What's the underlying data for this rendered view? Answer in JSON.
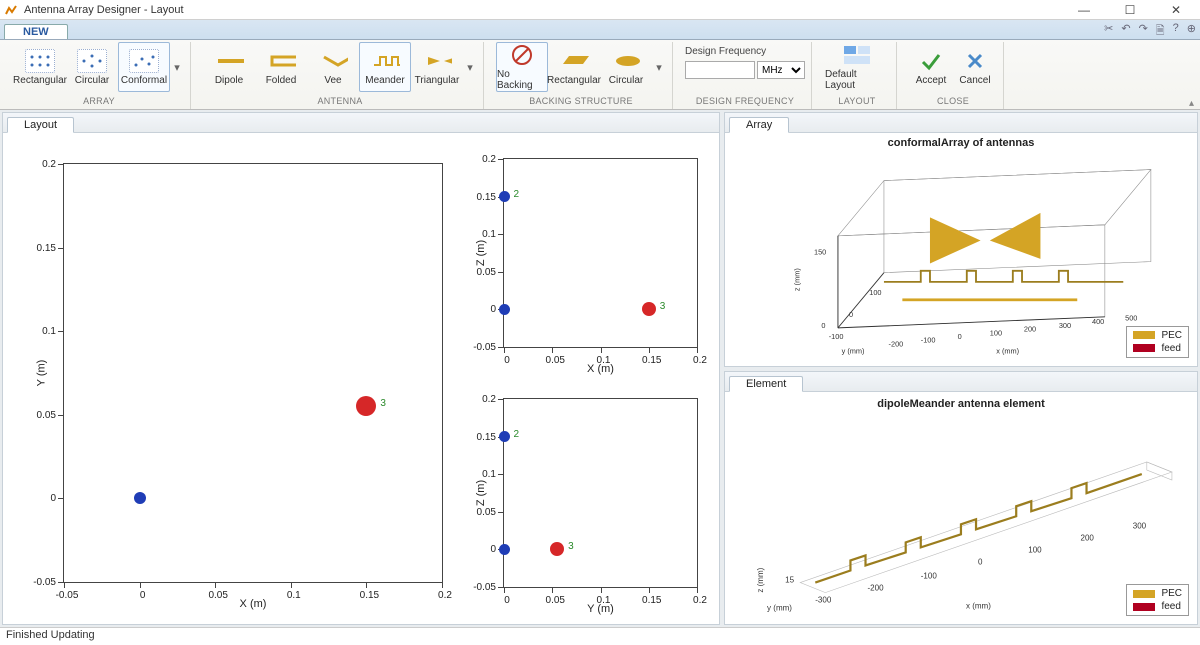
{
  "window": {
    "title": "Antenna Array Designer - Layout"
  },
  "ribbon": {
    "tab": "NEW",
    "groups": {
      "array": {
        "label": "ARRAY",
        "items": [
          {
            "name": "Rectangular"
          },
          {
            "name": "Circular"
          },
          {
            "name": "Conformal"
          }
        ]
      },
      "antenna": {
        "label": "ANTENNA",
        "items": [
          {
            "name": "Dipole"
          },
          {
            "name": "Folded"
          },
          {
            "name": "Vee"
          },
          {
            "name": "Meander"
          },
          {
            "name": "Triangular"
          }
        ]
      },
      "backing": {
        "label": "BACKING STRUCTURE",
        "items": [
          {
            "name": "No Backing"
          },
          {
            "name": "Rectangular"
          },
          {
            "name": "Circular"
          }
        ]
      },
      "design_freq": {
        "label": "DESIGN FREQUENCY",
        "heading": "Design Frequency",
        "unit": "MHz"
      },
      "layout_btn": {
        "label": "LAYOUT",
        "btn": "Default Layout"
      },
      "close": {
        "label": "CLOSE",
        "accept": "Accept",
        "cancel": "Cancel"
      }
    }
  },
  "panes": {
    "layout_tab": "Layout",
    "array_tab": "Array",
    "element_tab": "Element"
  },
  "chart_data": [
    {
      "type": "scatter",
      "id": "layout_xy",
      "xlabel": "X (m)",
      "ylabel": "Y (m)",
      "xticks": [
        -0.05,
        0,
        0.05,
        0.1,
        0.15,
        0.2
      ],
      "yticks": [
        -0.05,
        0,
        0.05,
        0.1,
        0.15,
        0.2
      ],
      "points": [
        {
          "x": 0,
          "y": 0,
          "color": "blue",
          "label": ""
        },
        {
          "x": 0.15,
          "y": 0.055,
          "color": "red",
          "label": "3"
        }
      ]
    },
    {
      "type": "scatter",
      "id": "layout_xz",
      "xlabel": "X (m)",
      "ylabel": "Z (m)",
      "xticks": [
        0,
        0.05,
        0.1,
        0.15,
        0.2
      ],
      "yticks": [
        -0.05,
        0,
        0.05,
        0.1,
        0.15,
        0.2
      ],
      "points": [
        {
          "x": 0,
          "y": 0,
          "color": "blue",
          "label": ""
        },
        {
          "x": 0,
          "y": 0.15,
          "color": "blue",
          "label": "2"
        },
        {
          "x": 0.15,
          "y": 0,
          "color": "red",
          "label": "3"
        }
      ]
    },
    {
      "type": "scatter",
      "id": "layout_yz",
      "xlabel": "Y (m)",
      "ylabel": "Z (m)",
      "xticks": [
        0,
        0.05,
        0.1,
        0.15,
        0.2
      ],
      "yticks": [
        -0.05,
        0,
        0.05,
        0.1,
        0.15,
        0.2
      ],
      "points": [
        {
          "x": 0,
          "y": 0,
          "color": "blue",
          "label": ""
        },
        {
          "x": 0,
          "y": 0.15,
          "color": "blue",
          "label": "2"
        },
        {
          "x": 0.055,
          "y": 0,
          "color": "red",
          "label": "3"
        }
      ]
    }
  ],
  "view3d": {
    "array_title": "conformalArray of antennas",
    "element_title": "dipoleMeander antenna element",
    "axes": {
      "x": "x (mm)",
      "y": "y (mm)",
      "z": "z (mm)"
    },
    "array_xticks": [
      -200,
      -100,
      0,
      100,
      200,
      300,
      400,
      500
    ],
    "array_yticks": [
      -100,
      0,
      100
    ],
    "array_zticks": [
      0,
      150
    ],
    "element_xticks": [
      -300,
      -200,
      -100,
      0,
      100,
      200,
      300
    ],
    "element_zticks": [
      15
    ],
    "legend": [
      {
        "label": "PEC",
        "color": "#d4a425"
      },
      {
        "label": "feed",
        "color": "#b00020"
      }
    ]
  },
  "status": "Finished Updating"
}
